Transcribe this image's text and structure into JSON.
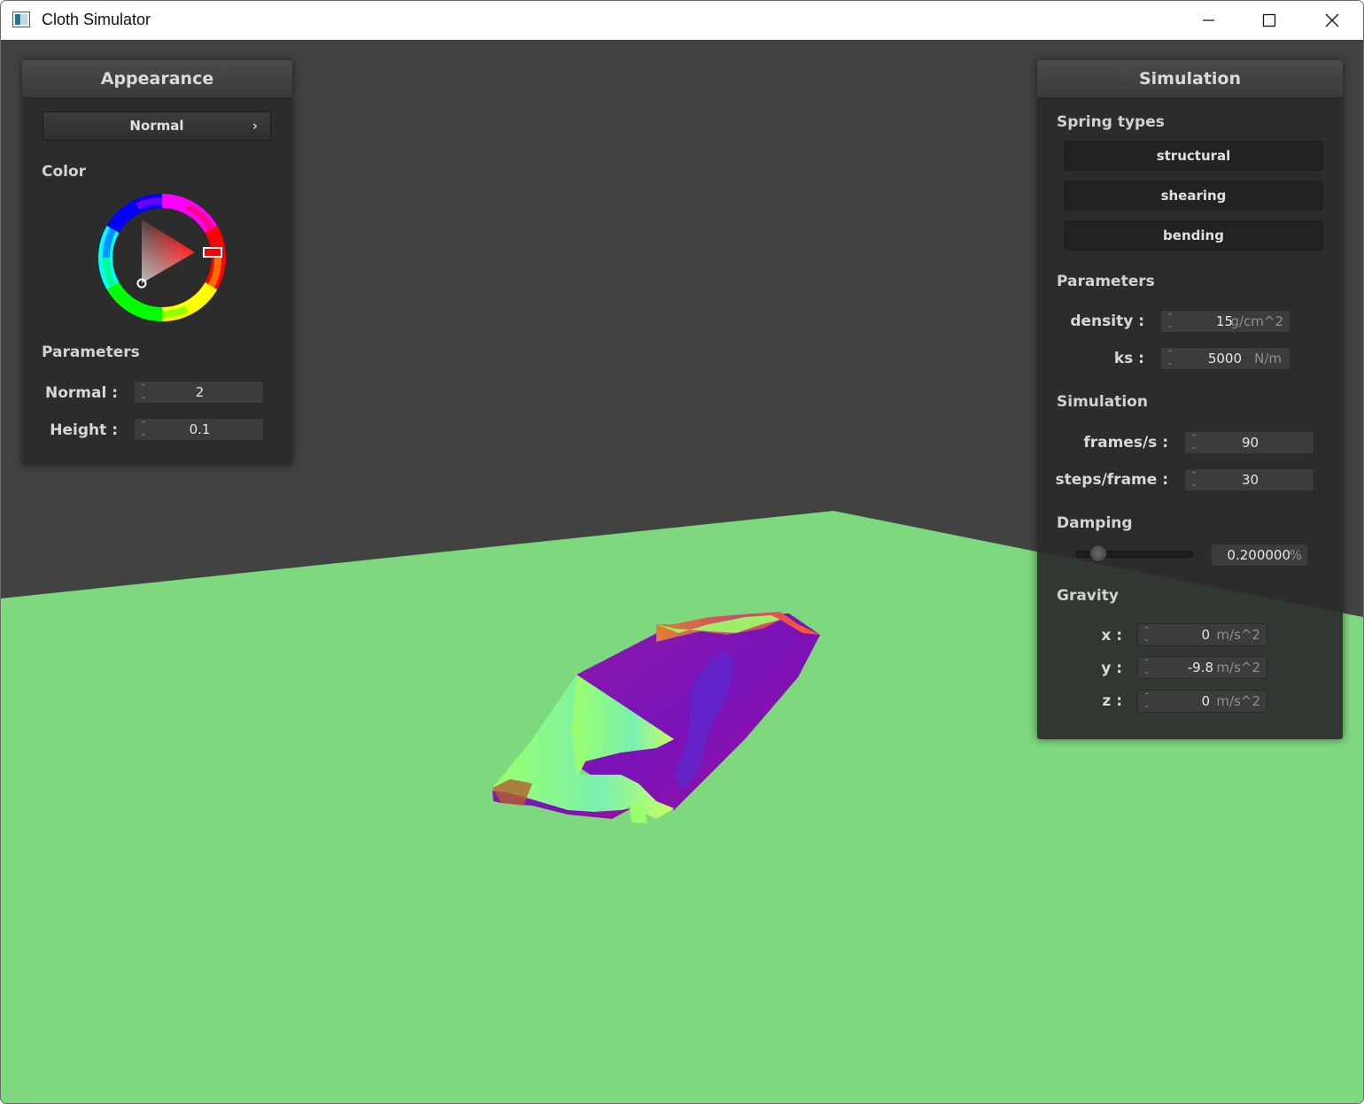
{
  "window": {
    "title": "Cloth Simulator",
    "controls": {
      "minimize": "─",
      "maximize": "☐",
      "close": "✕"
    }
  },
  "appearance_panel": {
    "title": "Appearance",
    "shader_select": {
      "value": "Normal",
      "chevron": "›"
    },
    "color_label": "Color",
    "selected_color": "#ff0000",
    "parameters_label": "Parameters",
    "normal": {
      "label": "Normal :",
      "value": "2"
    },
    "height": {
      "label": "Height :",
      "value": "0.1"
    }
  },
  "simulation_panel": {
    "title": "Simulation",
    "spring_types_label": "Spring types",
    "spring_buttons": [
      "structural",
      "shearing",
      "bending"
    ],
    "parameters_label": "Parameters",
    "density": {
      "label": "density :",
      "value": "15",
      "unit": "g/cm^2"
    },
    "ks": {
      "label": "ks :",
      "value": "5000",
      "unit": "N/m"
    },
    "simulation_label": "Simulation",
    "fps": {
      "label": "frames/s :",
      "value": "90"
    },
    "steps": {
      "label": "steps/frame :",
      "value": "30"
    },
    "damping_label": "Damping",
    "damping": {
      "value": "0.200000",
      "unit": "%",
      "level": 0.2
    },
    "gravity_label": "Gravity",
    "gravity": [
      {
        "label": "x :",
        "value": "0",
        "unit": "m/s^2"
      },
      {
        "label": "y :",
        "value": "-9.8",
        "unit": "m/s^2"
      },
      {
        "label": "z :",
        "value": "0",
        "unit": "m/s^2"
      }
    ]
  },
  "colors": {
    "background": "#424242",
    "ground_plane": "#7ed87e",
    "panel": "#2b2b2b"
  }
}
